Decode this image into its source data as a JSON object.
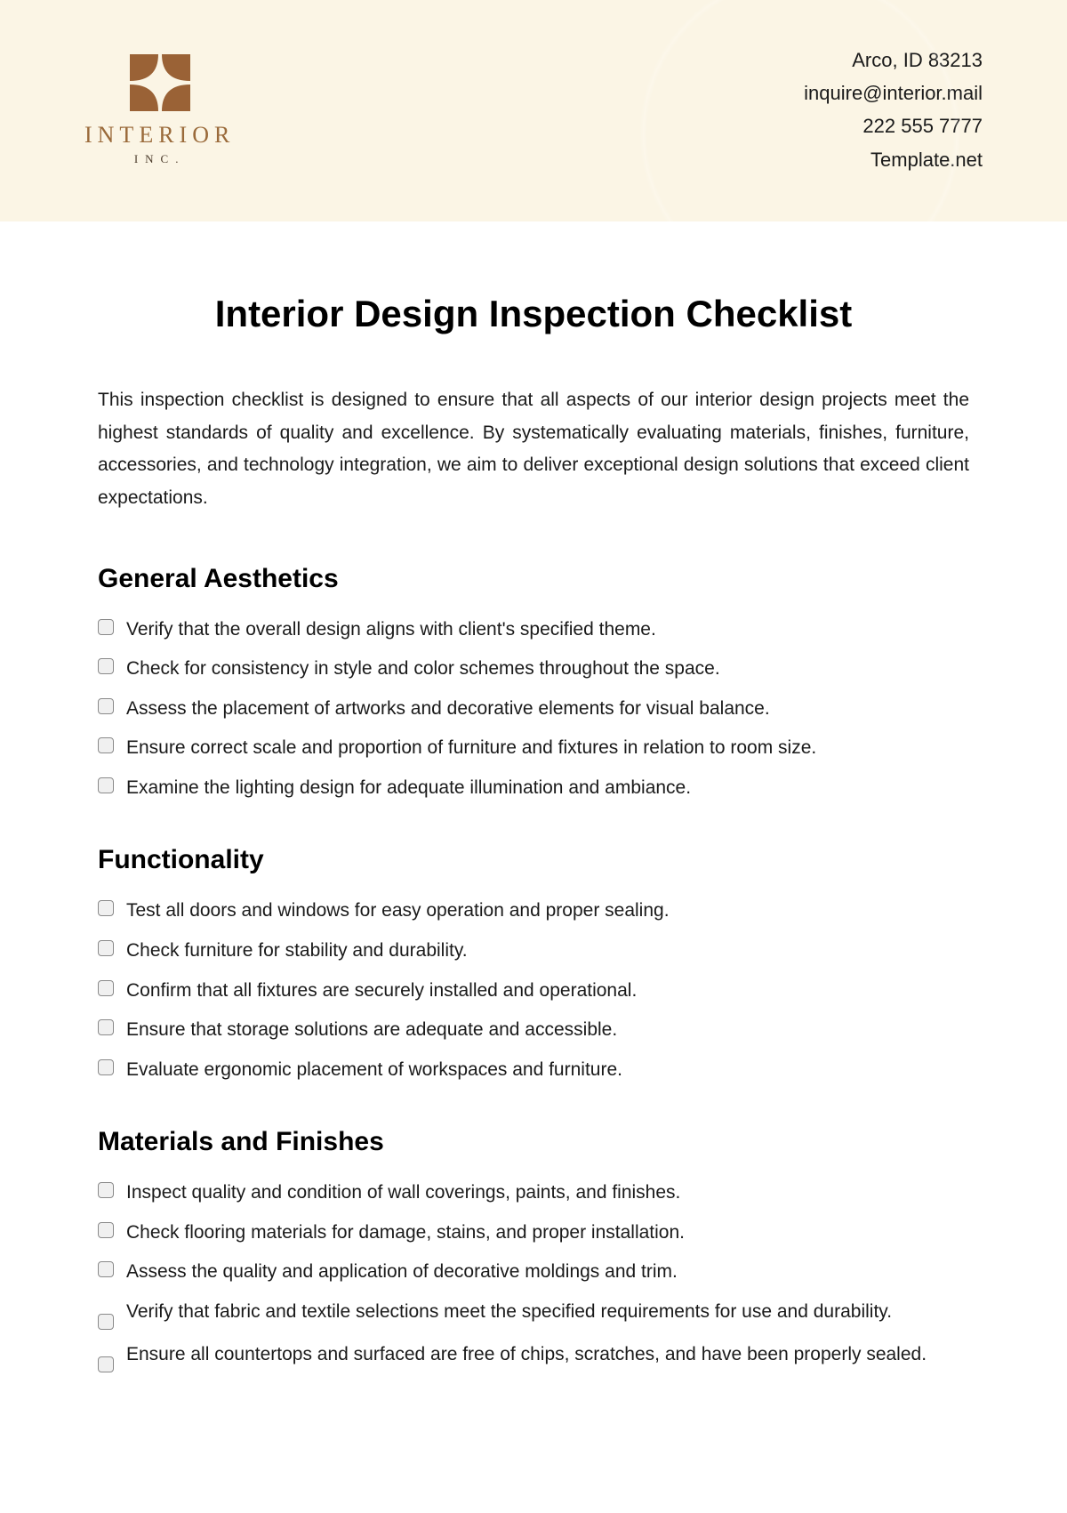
{
  "logo": {
    "brand": "INTERIOR",
    "sub": "INC."
  },
  "contact": {
    "address": "Arco, ID 83213",
    "email": "inquire@interior.mail",
    "phone": "222 555 7777",
    "site": "Template.net"
  },
  "title": "Interior Design Inspection Checklist",
  "intro": "This inspection checklist is designed to ensure that all aspects of our interior design projects meet the highest standards of quality and excellence. By systematically evaluating materials, finishes, furniture, accessories, and technology integration, we aim to deliver exceptional design solutions that exceed client expectations.",
  "sections": [
    {
      "heading": "General Aesthetics",
      "items": [
        "Verify that the overall design aligns with client's specified theme.",
        "Check for consistency in style and color schemes throughout the space.",
        "Assess the placement of artworks and decorative elements for visual balance.",
        "Ensure correct scale and proportion of furniture and fixtures in relation to room size.",
        "Examine the lighting design for adequate illumination and ambiance."
      ]
    },
    {
      "heading": "Functionality",
      "items": [
        "Test all doors and windows for easy operation and proper sealing.",
        "Check furniture for stability and durability.",
        "Confirm that all fixtures are securely installed and operational.",
        "Ensure that storage solutions are adequate and accessible.",
        "Evaluate ergonomic placement of workspaces and furniture."
      ]
    },
    {
      "heading": "Materials and Finishes",
      "items": [
        "Inspect quality and condition of wall coverings, paints, and finishes.",
        "Check flooring materials for damage, stains, and proper installation.",
        "Assess the quality and application of decorative moldings and trim.",
        "Verify that fabric and textile selections meet the specified requirements for use and durability.",
        "Ensure all countertops and surfaced are free of chips, scratches, and have been properly sealed."
      ]
    }
  ]
}
